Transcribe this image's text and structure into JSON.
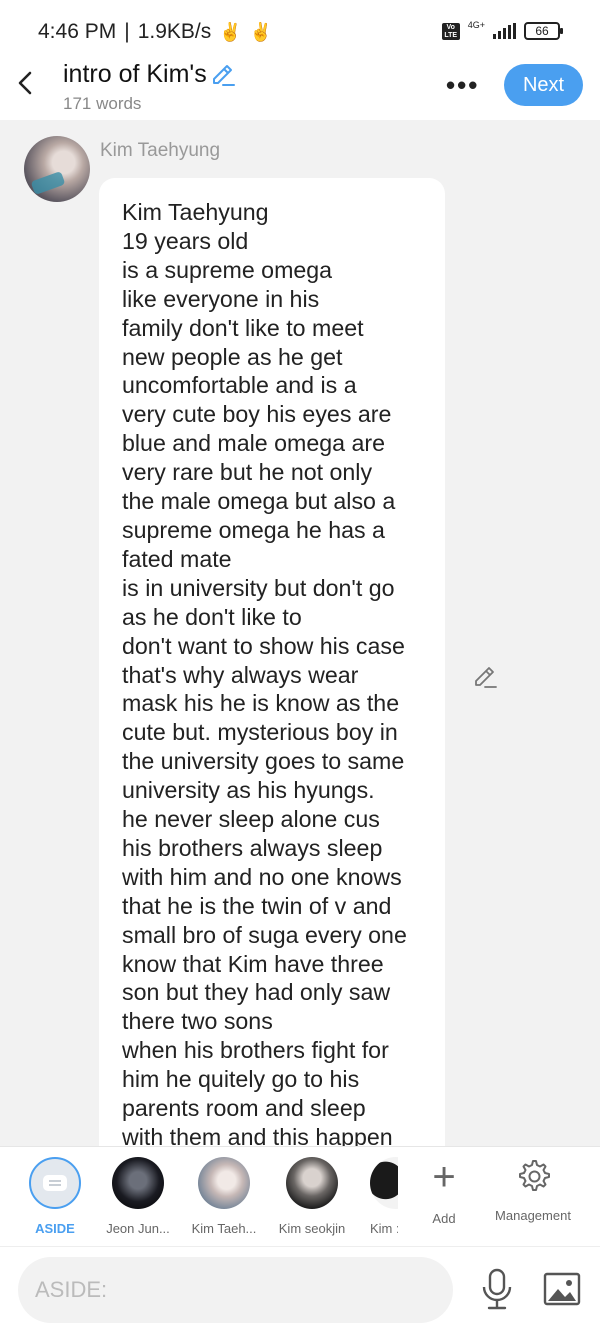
{
  "status_bar": {
    "time": "4:46 PM",
    "separator": "|",
    "speed": "1.9KB/s",
    "hand_icon": "✌",
    "volte": "Vo LTE",
    "network": "4G+",
    "battery": "66"
  },
  "header": {
    "title": "intro of Kim's",
    "word_count": "171 words",
    "more_glyph": "•••",
    "next_label": "Next"
  },
  "message": {
    "speaker": "Kim Taehyung",
    "text": "Kim Taehyung\n19 years old\nis a supreme omega\nlike everyone in his\nfamily don't like to meet\nnew people as he get\nuncomfortable and is a\nvery cute boy his eyes are\nblue and male omega are\nvery rare but he not only\nthe male omega but also a\nsupreme omega he has a\nfated mate\nis in university but don't go\nas he don't like to\ndon't want to show his case\nthat's why always wear\nmask his he is know as the\ncute but. mysterious boy in\nthe university goes to same\nuniversity as his hyungs.\nhe never sleep alone cus\nhis brothers always sleep\nwith him and no one knows\nthat he is the twin of v and\nsmall bro of suga every one\nknow that Kim have three\nson but they had only saw\nthere two sons\nwhen his brothers fight for\nhim he quitely go to his\nparents room and sleep\nwith them and this happen"
  },
  "cast_bar": {
    "aside_label": "ASIDE",
    "characters": [
      {
        "label": "Jeon Jun..."
      },
      {
        "label": "Kim Taeh..."
      },
      {
        "label": "Kim seokjin"
      },
      {
        "label": "Kim :"
      }
    ],
    "add_label": "Add",
    "management_label": "Management"
  },
  "input": {
    "placeholder": "ASIDE:"
  },
  "colors": {
    "accent": "#4a9ff0",
    "background": "#f2f2f2"
  }
}
